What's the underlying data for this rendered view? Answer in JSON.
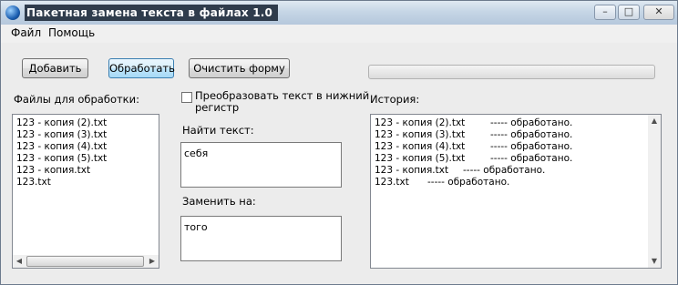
{
  "window": {
    "title": "Пакетная замена текста в файлах 1.0"
  },
  "menu": {
    "file": "Файл",
    "help": "Помощь"
  },
  "toolbar": {
    "add": "Добавить",
    "process": "Обработать",
    "clear": "Очистить форму"
  },
  "progress": {
    "value": 0
  },
  "files": {
    "label": "Файлы для обработки:",
    "items": [
      "123 - копия (2).txt",
      "123 - копия (3).txt",
      "123 - копия (4).txt",
      "123 - копия (5).txt",
      "123 - копия.txt",
      "123.txt"
    ]
  },
  "options": {
    "lowercase_label_line1": "Преобразовать текст в нижний",
    "lowercase_label_line2": "регистр",
    "lowercase_checked": false
  },
  "find": {
    "label": "Найти текст:",
    "value": "себя"
  },
  "replace": {
    "label": "Заменить на:",
    "value": "того"
  },
  "history": {
    "label": "История:",
    "entries": [
      {
        "file": "123 - копия (2).txt",
        "status": "----- обработано."
      },
      {
        "file": "123 - копия (3).txt",
        "status": "----- обработано."
      },
      {
        "file": "123 - копия (4).txt",
        "status": "----- обработано."
      },
      {
        "file": "123 - копия (5).txt",
        "status": "----- обработано."
      },
      {
        "file": "123 - копия.txt",
        "status": "----- обработано."
      },
      {
        "file": "123.txt",
        "status": "----- обработано."
      }
    ]
  },
  "colors": {
    "title_bg": "#2f3c4c",
    "accent": "#3c7fb1"
  }
}
